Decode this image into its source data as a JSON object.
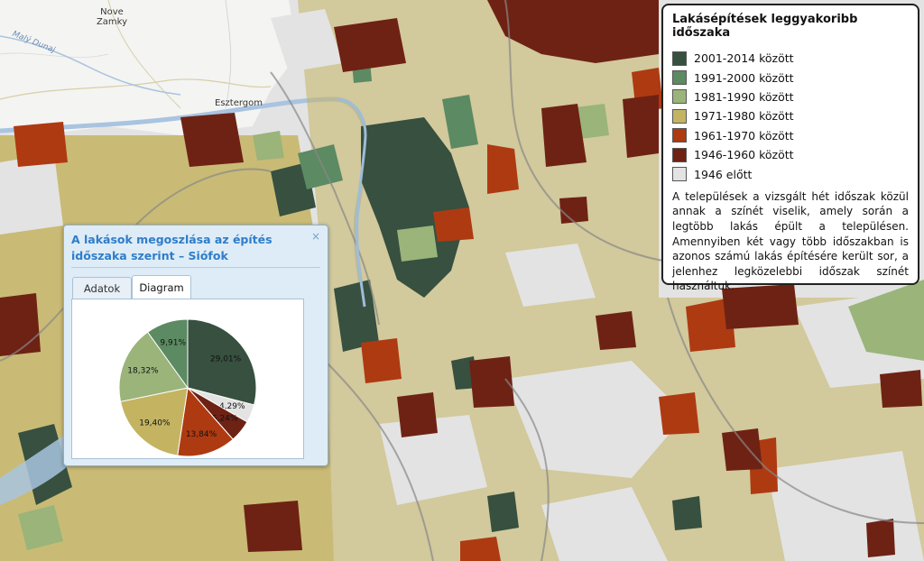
{
  "map": {
    "place_labels": [
      "Nove Zamky",
      "Esztergom"
    ],
    "river_label": "Malý Dunaj",
    "colors": {
      "c2001": "#37503f",
      "c1991": "#5c8a62",
      "c1981": "#9ab47a",
      "c1971": "#c4b462",
      "c1961": "#ae3a12",
      "c1946": "#6e2214",
      "cpre": "#e3e3e3"
    }
  },
  "legend": {
    "title": "Lakásépítések leggyakoribb időszaka",
    "items": [
      {
        "label": "2001-2014 között",
        "color": "#37503f"
      },
      {
        "label": "1991-2000 között",
        "color": "#5c8a62"
      },
      {
        "label": "1981-1990 között",
        "color": "#9ab47a"
      },
      {
        "label": "1971-1980 között",
        "color": "#c4b462"
      },
      {
        "label": "1961-1970 között",
        "color": "#ae3a12"
      },
      {
        "label": "1946-1960 között",
        "color": "#6e2214"
      },
      {
        "label": "1946 előtt",
        "color": "#e3e3e3"
      }
    ],
    "description": "A települések a vizsgált hét időszak közül annak a színét viselik, amely során a legtöbb lakás épült a településen. Amennyiben két vagy több időszakban is azonos számú lakás építésére került sor, a jelenhez legközelebbi időszak színét használtuk."
  },
  "popup": {
    "title": "A lakások megoszlása az építés időszaka szerint – Siófok",
    "close_symbol": "×",
    "tabs": [
      {
        "label": "Adatok",
        "active": false
      },
      {
        "label": "Diagram",
        "active": true
      }
    ]
  },
  "chart_data": {
    "type": "pie",
    "slices": [
      {
        "period": "2001-2014 között",
        "value": 29.01,
        "label": "29,01%",
        "color": "#37503f"
      },
      {
        "period": "1946 előtt",
        "value": 4.29,
        "label": "4,29%",
        "color": "#e3e3e3"
      },
      {
        "period": "1946-1960 között",
        "value": 5.24,
        "label": "5,24%",
        "color": "#6e2214"
      },
      {
        "period": "1961-1970 között",
        "value": 13.84,
        "label": "13,84%",
        "color": "#ae3a12"
      },
      {
        "period": "1971-1980 között",
        "value": 19.4,
        "label": "19,40%",
        "color": "#c4b462"
      },
      {
        "period": "1981-1990 között",
        "value": 18.32,
        "label": "18,32%",
        "color": "#9ab47a"
      },
      {
        "period": "1991-2000 között",
        "value": 9.91,
        "label": "9,91%",
        "color": "#5c8a62"
      }
    ]
  }
}
